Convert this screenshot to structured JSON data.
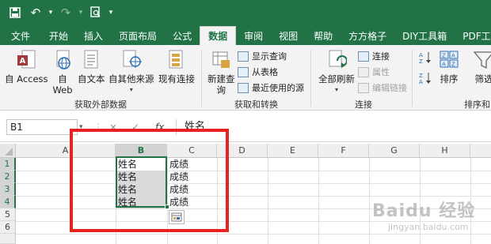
{
  "quick_access": {
    "save_icon": "save-icon",
    "undo_icon": "undo-icon",
    "redo_icon": "redo-icon",
    "preview_icon": "print-preview-icon",
    "more_icon": "customize-icon"
  },
  "tabs": [
    {
      "label": "文件"
    },
    {
      "label": "开始"
    },
    {
      "label": "插入"
    },
    {
      "label": "页面布局"
    },
    {
      "label": "公式"
    },
    {
      "label": "数据"
    },
    {
      "label": "审阅"
    },
    {
      "label": "视图"
    },
    {
      "label": "帮助"
    },
    {
      "label": "方方格子"
    },
    {
      "label": "DIY工具箱"
    },
    {
      "label": "PDF工具"
    }
  ],
  "ribbon": {
    "get_external": {
      "access": "自 Access",
      "web_1": "自",
      "web_2": "Web",
      "text": "自文本",
      "other": "自其他来源",
      "existing": "现有连接",
      "label": "获取外部数据"
    },
    "get_transform": {
      "new_query_1": "新建查",
      "new_query_2": "询",
      "show_queries": "显示查询",
      "from_table": "从表格",
      "recent_sources": "最近使用的源",
      "label": "获取和转换"
    },
    "connections": {
      "refresh_all": "全部刷新",
      "connections": "连接",
      "properties": "属性",
      "edit_links": "编辑链接",
      "label": "连接"
    },
    "sort_filter": {
      "sort": "排序",
      "filter": "筛选",
      "label": "排序和"
    }
  },
  "formula_bar": {
    "name_box": "B1",
    "cancel": "×",
    "enter": "✓",
    "fx": "fx",
    "content": "姓名"
  },
  "sheet": {
    "columns": [
      "A",
      "B",
      "C",
      "D",
      "E",
      "F",
      "G",
      "H"
    ],
    "rows": [
      "1",
      "2",
      "3",
      "4",
      "5",
      "6"
    ],
    "b_cells": [
      "姓名",
      "姓名",
      "姓名",
      "姓名"
    ],
    "c_cells": [
      "成绩",
      "成绩",
      "成绩",
      "成绩"
    ]
  },
  "watermark": {
    "main": "Baidu 经验",
    "sub": "jingyan.baidu.com"
  },
  "colors": {
    "excel_green": "#217346",
    "highlight_red": "#e8221e",
    "selection_gray": "#d9d9d9"
  }
}
